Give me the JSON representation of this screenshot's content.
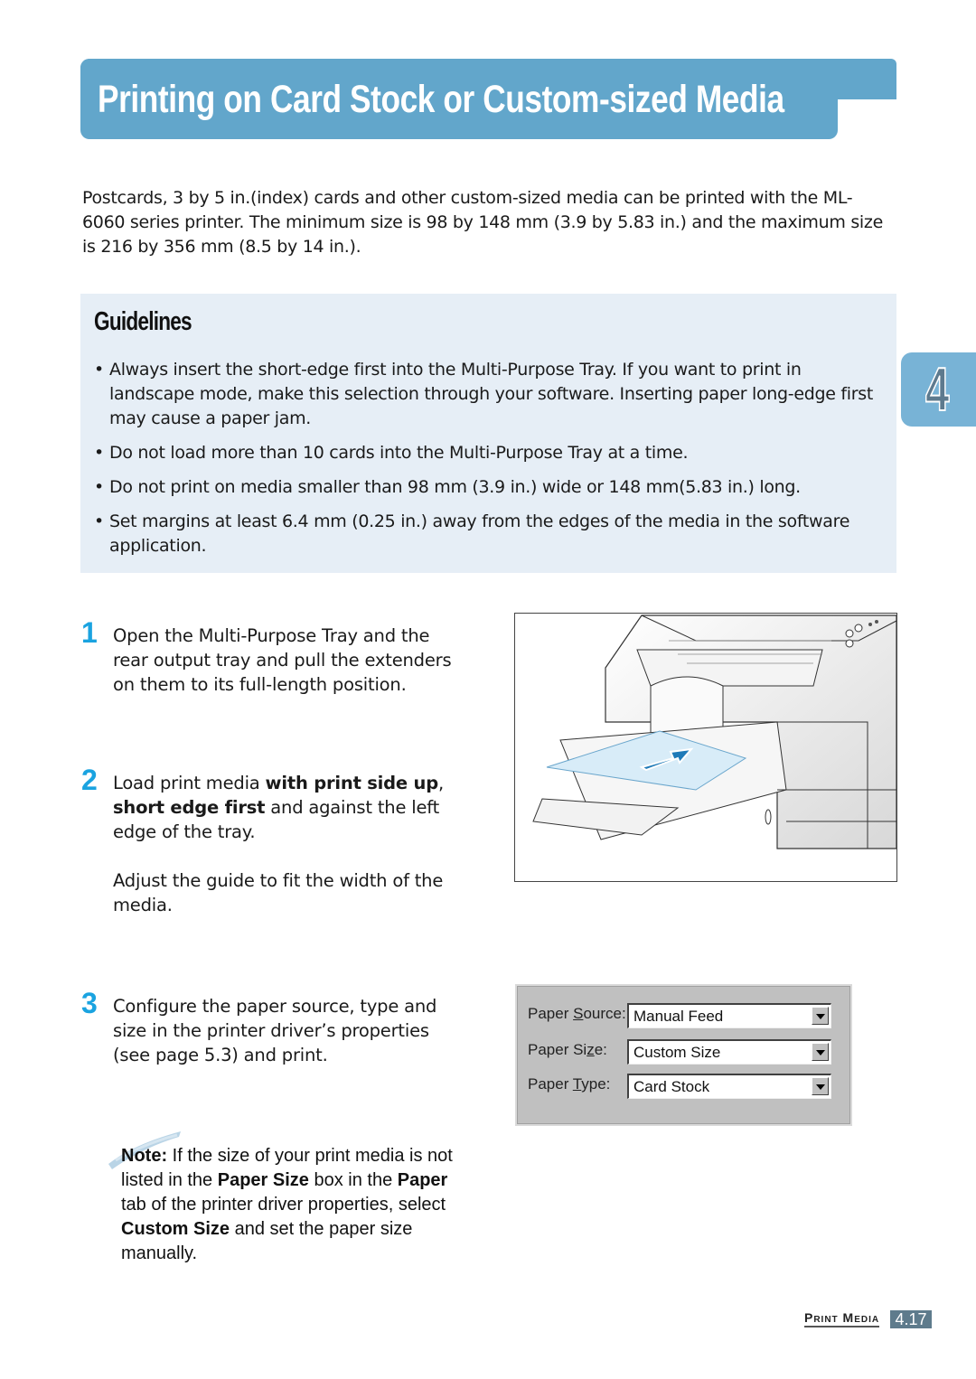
{
  "header": {
    "title": "Printing on Card Stock or Custom-sized Media"
  },
  "intro": "Postcards, 3 by 5 in.(index) cards and other custom-sized media can be printed with the ML-6060 series printer. The minimum size is 98 by 148 mm (3.9 by 5.83 in.) and the maximum size is 216 by 356 mm (8.5 by 14 in.).",
  "guidelines": {
    "title": "Guidelines",
    "items": [
      "Always insert the short-edge first into the Multi-Purpose Tray. If you want to print in landscape mode, make this selection through your software. Inserting paper long-edge first may cause a paper jam.",
      "Do not load more than 10 cards into the Multi-Purpose Tray at a time.",
      "Do not print on media smaller than 98 mm (3.9 in.) wide or 148 mm(5.83 in.) long.",
      "Set margins at least 6.4 mm (0.25 in.) away from the edges of the media in the software application."
    ]
  },
  "chapter_tab": "4",
  "steps": [
    {
      "number": "1",
      "text": "Open the Multi-Purpose Tray and the rear output tray and pull the extenders on them to its full-length position."
    },
    {
      "number": "2",
      "text_pre": "Load print media ",
      "bold1": "with print side up",
      "text_mid": ", ",
      "bold2": "short edge first",
      "text_post": " and against the left edge of the tray.",
      "extra": "Adjust the guide to fit the width of the media."
    },
    {
      "number": "3",
      "text": "Configure the paper source, type and size in the printer driver’s properties (see page 5.3) and print."
    }
  ],
  "figure": {
    "alt": "printer-multipurpose-tray-illustration"
  },
  "dialog": {
    "rows": [
      {
        "label_pre": "Paper ",
        "label_key": "S",
        "label_post": "ource:",
        "value": "Manual Feed"
      },
      {
        "label_pre": "Paper Si",
        "label_key": "z",
        "label_post": "e:",
        "value": "Custom Size"
      },
      {
        "label_pre": "Paper ",
        "label_key": "T",
        "label_post": "ype:",
        "value": "Card Stock"
      }
    ]
  },
  "note": {
    "label": "Note:",
    "t1": " If the size of your print media is not listed in the ",
    "b1": "Paper Size",
    "t2": " box in the ",
    "b2": "Paper",
    "t3": " tab of the printer driver properties, select ",
    "b3": "Custom Size",
    "t4": " and set the paper size manually."
  },
  "footer": {
    "section": "Print Media",
    "page": "4.17"
  }
}
